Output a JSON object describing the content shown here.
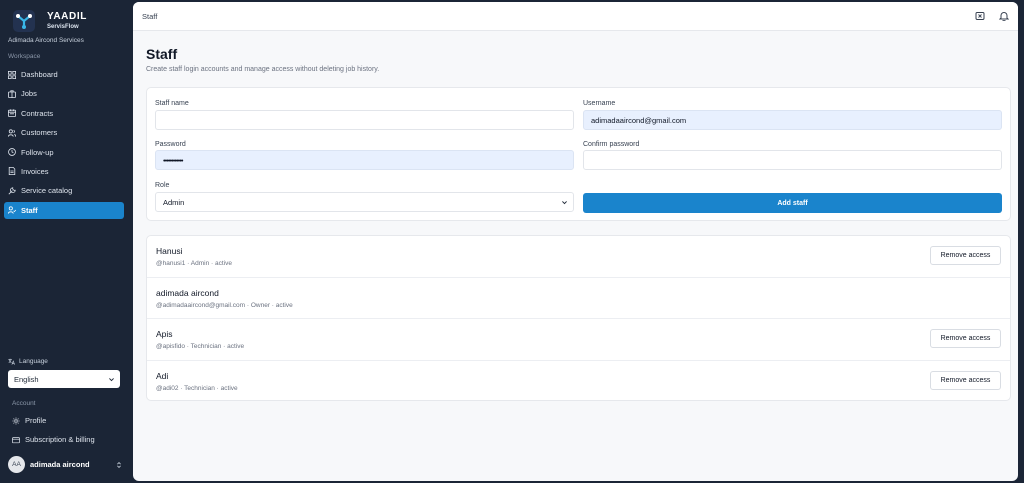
{
  "brand": {
    "name": "YAADIL",
    "subtitle": "ServisFlow"
  },
  "company": "Adimada Aircond Services",
  "sidebar": {
    "workspace_label": "Workspace",
    "items": [
      {
        "label": "Dashboard",
        "icon": "grid-icon"
      },
      {
        "label": "Jobs",
        "icon": "briefcase-icon"
      },
      {
        "label": "Contracts",
        "icon": "calendar-icon"
      },
      {
        "label": "Customers",
        "icon": "users-icon"
      },
      {
        "label": "Follow-up",
        "icon": "clock-icon"
      },
      {
        "label": "Invoices",
        "icon": "file-icon"
      },
      {
        "label": "Service catalog",
        "icon": "wrench-icon"
      },
      {
        "label": "Staff",
        "icon": "staff-icon",
        "active": true
      }
    ],
    "language_label": "Language",
    "language_value": "English",
    "account_label": "Account",
    "account_items": [
      {
        "label": "Profile",
        "icon": "gear-icon"
      },
      {
        "label": "Subscription & billing",
        "icon": "card-icon"
      }
    ],
    "user": {
      "initials": "AA",
      "name": "adimada aircond"
    }
  },
  "topbar": {
    "title": "Staff"
  },
  "page": {
    "title": "Staff",
    "subtitle": "Create staff login accounts and manage access without deleting job history."
  },
  "form": {
    "staff_name_label": "Staff name",
    "staff_name_value": "",
    "username_label": "Username",
    "username_value": "adimadaaircond@gmail.com",
    "password_label": "Password",
    "password_value": "••••••••••••",
    "confirm_password_label": "Confirm password",
    "confirm_password_value": "",
    "role_label": "Role",
    "role_value": "Admin",
    "submit_label": "Add staff"
  },
  "staff": [
    {
      "name": "Hanusi",
      "meta": "@hanusi1 · Admin · active",
      "action": "Remove access"
    },
    {
      "name": "adimada aircond",
      "meta": "@adimadaaircond@gmail.com · Owner · active",
      "action": ""
    },
    {
      "name": "Apis",
      "meta": "@apisfido · Technician · active",
      "action": "Remove access"
    },
    {
      "name": "Adi",
      "meta": "@adi02 · Technician · active",
      "action": "Remove access"
    }
  ],
  "colors": {
    "accent": "#1a84cc",
    "sidebar_bg": "#1b2536",
    "autofill_bg": "#e8f0fe"
  }
}
